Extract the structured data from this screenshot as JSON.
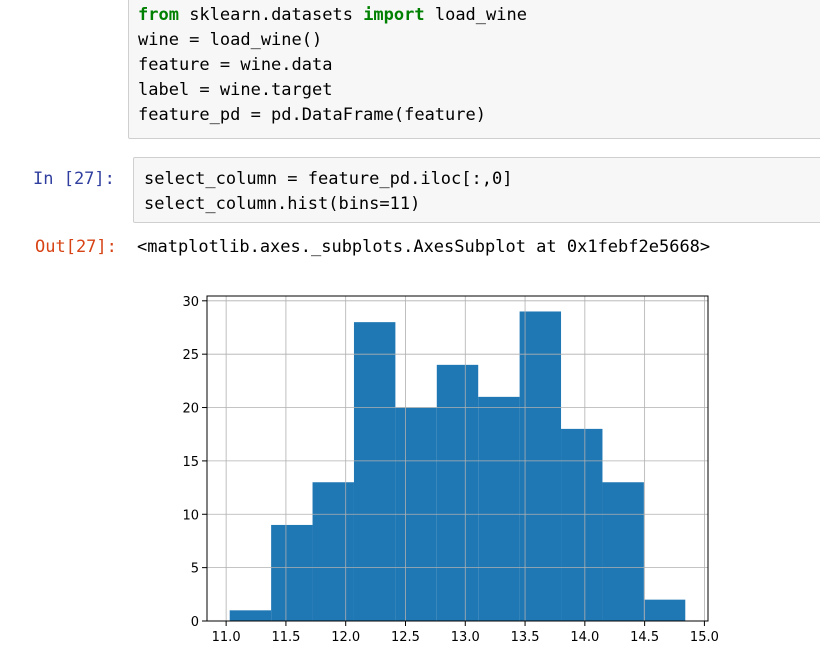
{
  "cell1": {
    "lines": [
      {
        "kw": "from",
        "a": " sklearn.datasets ",
        "kw2": "import",
        "b": " load_wine"
      },
      "wine = load_wine()",
      "feature = wine.data",
      "label = wine.target",
      "feature_pd = pd.DataFrame(feature)"
    ]
  },
  "cell2": {
    "in_prompt": "In  [27]:",
    "line1": "select_column = feature_pd.iloc[:,0]",
    "line2": "select_column.hist(bins=11)",
    "out_prompt": "Out[27]:",
    "out_text": "<matplotlib.axes._subplots.AxesSubplot at 0x1febf2e5668>"
  },
  "colors": {
    "bar": "#1f77b4",
    "grid": "#b0b0b0"
  },
  "chart_data": {
    "type": "bar",
    "bins": 11,
    "bin_edges": [
      11.03,
      11.3764,
      11.7227,
      12.0691,
      12.4155,
      12.7618,
      13.1082,
      13.4545,
      13.8009,
      14.1473,
      14.4936,
      14.84
    ],
    "values": [
      1,
      9,
      13,
      28,
      20,
      24,
      21,
      29,
      18,
      13,
      2
    ],
    "xticks": [
      "11.0",
      "11.5",
      "12.0",
      "12.5",
      "13.0",
      "13.5",
      "14.0",
      "14.5",
      "15.0"
    ],
    "xtick_values": [
      11.0,
      11.5,
      12.0,
      12.5,
      13.0,
      13.5,
      14.0,
      14.5,
      15.0
    ],
    "yticks": [
      "0",
      "5",
      "10",
      "15",
      "20",
      "25",
      "30"
    ],
    "ytick_values": [
      0,
      5,
      10,
      15,
      20,
      25,
      30
    ],
    "xlim": [
      10.84,
      15.03
    ],
    "ylim": [
      0,
      30.45
    ],
    "grid": true,
    "title": "",
    "xlabel": "",
    "ylabel": ""
  }
}
